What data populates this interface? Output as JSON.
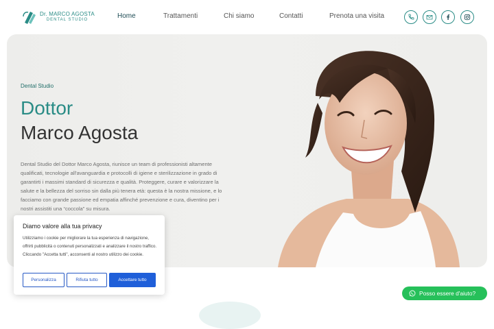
{
  "brand": {
    "name": "Dr. MARCO AGOSTA",
    "subtitle": "DENTAL STUDIO",
    "color": "#2a8c86"
  },
  "nav": {
    "items": [
      {
        "label": "Home",
        "active": true
      },
      {
        "label": "Trattamenti",
        "active": false
      },
      {
        "label": "Chi siamo",
        "active": false
      },
      {
        "label": "Contatti",
        "active": false
      },
      {
        "label": "Prenota una visita",
        "active": false
      }
    ]
  },
  "social_icons": [
    "phone-icon",
    "mail-icon",
    "facebook-icon",
    "instagram-icon"
  ],
  "hero": {
    "eyebrow": "Dental Studio",
    "title_line1": "Dottor",
    "title_line2": "Marco Agosta",
    "description": "Dental Studio del Dottor Marco Agosta, riunisce un team di professionisti altamente qualificati, tecnologie all'avanguardia e protocolli di igiene e sterilizzazione in grado di garantirti i massimi standard di sicurezza e qualità. Proteggere, curare e valorizzare la salute e la bellezza del sorriso sin dalla più tenera età: questa è la nostra missione, e lo facciamo con grande passione ed empatia affinché prevenzione e cura, diventino per i nostri assistiti una “coccola” su misura."
  },
  "cookie": {
    "title": "Diamo valore alla tua privacy",
    "text": "Utilizziamo i cookie per migliorare la tua esperienza di navigazione, offrirti pubblicità o contenuti personalizzati e analizzare il nostro traffico. Cliccando \"Accetta tutti\", acconsenti al nostro utilizzo dei cookie.",
    "customize_label": "Personalizza",
    "reject_label": "Rifiuta tutto",
    "accept_label": "Accettare tutto"
  },
  "help": {
    "label": "Posso essere d'aiuto?"
  },
  "colors": {
    "accent": "#2a8c86",
    "cookie_button": "#1f5fd9",
    "whatsapp": "#26c05a"
  }
}
